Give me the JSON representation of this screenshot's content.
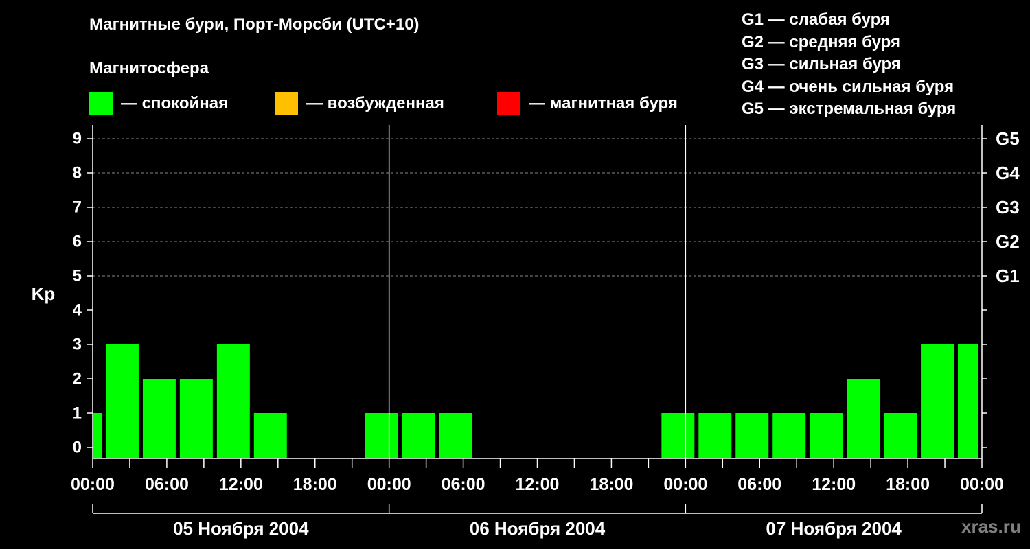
{
  "title": "Магнитные бури, Порт-Морсби (UTC+10)",
  "magnetosphere": {
    "title": "Магнитосфера",
    "legend": [
      {
        "label": "— спокойная",
        "color": "#00ff00"
      },
      {
        "label": "— возбужденная",
        "color": "#ffc000"
      },
      {
        "label": "— магнитная буря",
        "color": "#ff0000"
      }
    ]
  },
  "g_scale": [
    "G1 — слабая буря",
    "G2 — средняя буря",
    "G3 — сильная буря",
    "G4 — очень сильная буря",
    "G5 — экстремальная буря"
  ],
  "watermark": "xras.ru",
  "chart_data": {
    "type": "bar",
    "ylabel": "Kp",
    "ylim": [
      0,
      9
    ],
    "yticks": [
      0,
      1,
      2,
      3,
      4,
      5,
      6,
      7,
      8,
      9
    ],
    "right_labels": [
      {
        "value": 5,
        "label": "G1"
      },
      {
        "value": 6,
        "label": "G2"
      },
      {
        "value": 7,
        "label": "G3"
      },
      {
        "value": 8,
        "label": "G4"
      },
      {
        "value": 9,
        "label": "G5"
      }
    ],
    "x_range_hours": [
      0,
      72
    ],
    "xtick_labels": [
      "00:00",
      "06:00",
      "12:00",
      "18:00",
      "00:00",
      "06:00",
      "12:00",
      "18:00",
      "00:00",
      "06:00",
      "12:00",
      "18:00",
      "00:00"
    ],
    "days": [
      "05 Ноября 2004",
      "06 Ноября 2004",
      "07 Ноября 2004"
    ],
    "grid": "dashed horizontal at Kp 5–9",
    "bars": [
      {
        "start_hour": 0,
        "end_hour": 1,
        "kp": 1
      },
      {
        "start_hour": 1,
        "end_hour": 4,
        "kp": 3
      },
      {
        "start_hour": 4,
        "end_hour": 7,
        "kp": 2
      },
      {
        "start_hour": 7,
        "end_hour": 10,
        "kp": 2
      },
      {
        "start_hour": 10,
        "end_hour": 13,
        "kp": 3
      },
      {
        "start_hour": 13,
        "end_hour": 16,
        "kp": 1
      },
      {
        "start_hour": 16,
        "end_hour": 19,
        "kp": 0
      },
      {
        "start_hour": 19,
        "end_hour": 22,
        "kp": 0
      },
      {
        "start_hour": 22,
        "end_hour": 25,
        "kp": 1
      },
      {
        "start_hour": 25,
        "end_hour": 28,
        "kp": 1
      },
      {
        "start_hour": 28,
        "end_hour": 31,
        "kp": 1
      },
      {
        "start_hour": 31,
        "end_hour": 34,
        "kp": 0
      },
      {
        "start_hour": 34,
        "end_hour": 37,
        "kp": 0
      },
      {
        "start_hour": 37,
        "end_hour": 40,
        "kp": 0
      },
      {
        "start_hour": 40,
        "end_hour": 43,
        "kp": 0
      },
      {
        "start_hour": 43,
        "end_hour": 46,
        "kp": 0
      },
      {
        "start_hour": 46,
        "end_hour": 49,
        "kp": 1
      },
      {
        "start_hour": 49,
        "end_hour": 52,
        "kp": 1
      },
      {
        "start_hour": 52,
        "end_hour": 55,
        "kp": 1
      },
      {
        "start_hour": 55,
        "end_hour": 58,
        "kp": 1
      },
      {
        "start_hour": 58,
        "end_hour": 61,
        "kp": 1
      },
      {
        "start_hour": 61,
        "end_hour": 64,
        "kp": 2
      },
      {
        "start_hour": 64,
        "end_hour": 67,
        "kp": 1
      },
      {
        "start_hour": 67,
        "end_hour": 70,
        "kp": 3
      },
      {
        "start_hour": 70,
        "end_hour": 72,
        "kp": 3
      }
    ]
  }
}
